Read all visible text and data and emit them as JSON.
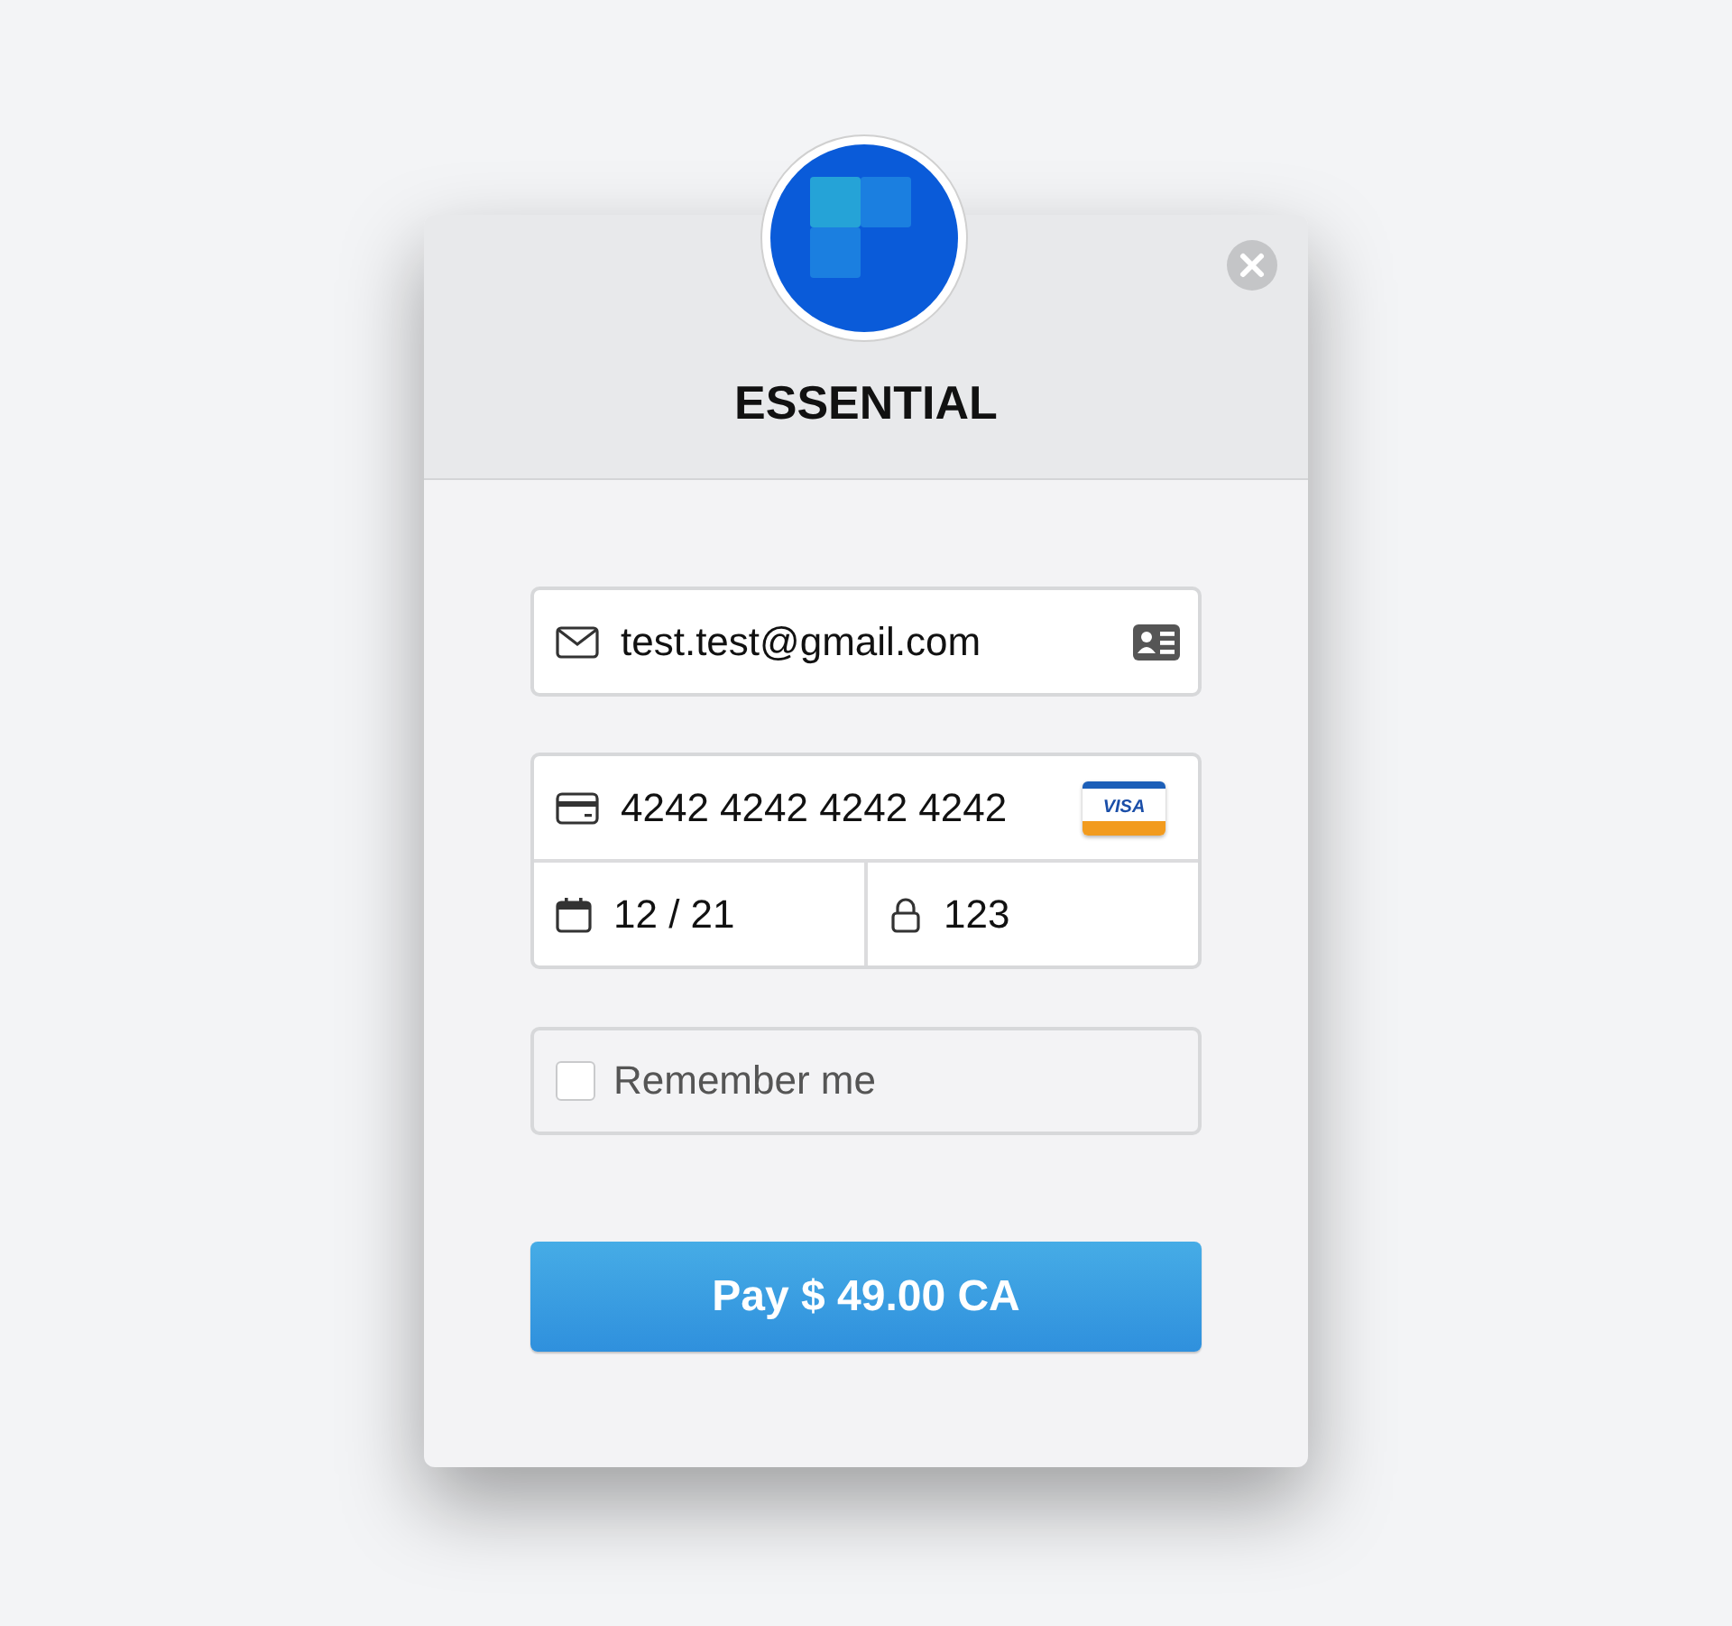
{
  "header": {
    "title": "ESSENTIAL"
  },
  "email": {
    "value": "test.test@gmail.com"
  },
  "card": {
    "number": "4242 4242 4242 4242",
    "brand": "VISA",
    "expiry": "12 / 21",
    "cvc": "123"
  },
  "remember": {
    "label": "Remember me",
    "checked": false
  },
  "pay_button": {
    "label": "Pay $ 49.00 CA"
  }
}
